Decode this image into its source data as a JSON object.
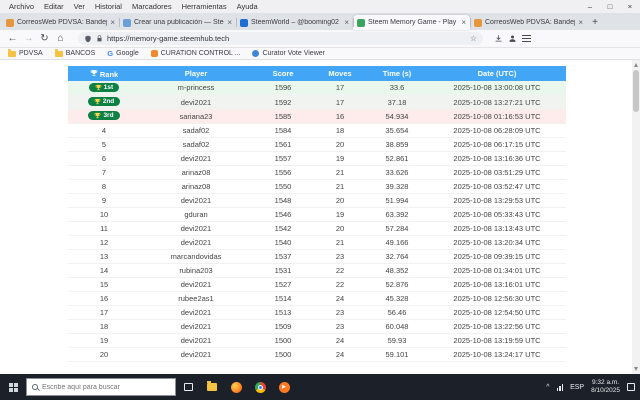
{
  "window_controls": [
    {
      "name": "minimize",
      "glyph": "–"
    },
    {
      "name": "maximize",
      "glyph": "□"
    },
    {
      "name": "close",
      "glyph": "×"
    }
  ],
  "menu_bar": {
    "items": [
      "Archivo",
      "Editar",
      "Ver",
      "Historial",
      "Marcadores",
      "Herramientas",
      "Ayuda"
    ]
  },
  "tab_strip": {
    "tabs": [
      {
        "label": "CorreosWeb PDVSA: Bandeja de",
        "favicon_color": "#e8963d",
        "active": false
      },
      {
        "label": "Crear una publicación — Steen",
        "favicon_color": "#6a9fd8",
        "active": false
      },
      {
        "label": "SteemWorld – @booming02",
        "favicon_color": "#1f6fd0",
        "active": false
      },
      {
        "label": "Steem Memory Game - Play an",
        "favicon_color": "#3aa55f",
        "active": true
      },
      {
        "label": "CorreosWeb PDVSA: Bandeja de",
        "favicon_color": "#e8963d",
        "active": false
      }
    ],
    "new_tab_label": "+"
  },
  "nav_bar": {
    "buttons": [
      {
        "name": "back",
        "glyph": "←",
        "disabled": false
      },
      {
        "name": "forward",
        "glyph": "→",
        "disabled": true
      },
      {
        "name": "reload",
        "glyph": "↻",
        "disabled": false
      },
      {
        "name": "home",
        "glyph": "⌂",
        "disabled": false
      }
    ],
    "url": "https://memory-game.steemhub.tech",
    "bookmark_star": "☆"
  },
  "bookmarks_bar": {
    "items": [
      {
        "label": "PDVSA",
        "icon": "folder"
      },
      {
        "label": "BANCOS",
        "icon": "folder"
      },
      {
        "label": "Google",
        "icon": "google"
      },
      {
        "label": "CURATION CONTROL ...",
        "icon": "orange"
      },
      {
        "label": "Curator Vote Viewer",
        "icon": "globe"
      }
    ]
  },
  "leaderboard": {
    "headers": [
      "Rank",
      "Player",
      "Score",
      "Moves",
      "Time (s)",
      "Date (UTC)"
    ],
    "header_color": "#42a5f5",
    "badge_color": "#0d8043",
    "rows": [
      {
        "rank": "1st",
        "badge": true,
        "highlight": "first",
        "player": "m-princess",
        "score": "1596",
        "moves": "17",
        "time": "33.6",
        "date": "2025-10-08 13:00:08 UTC"
      },
      {
        "rank": "2nd",
        "badge": true,
        "highlight": "second",
        "player": "devi2021",
        "score": "1592",
        "moves": "17",
        "time": "37.18",
        "date": "2025-10-08 13:27:21 UTC"
      },
      {
        "rank": "3rd",
        "badge": true,
        "highlight": "third",
        "player": "sariana23",
        "score": "1585",
        "moves": "16",
        "time": "54.934",
        "date": "2025-10-08 01:16:53 UTC"
      },
      {
        "rank": "4",
        "badge": false,
        "highlight": null,
        "player": "sadaf02",
        "score": "1584",
        "moves": "18",
        "time": "35.654",
        "date": "2025-10-08 06:28:09 UTC"
      },
      {
        "rank": "5",
        "badge": false,
        "highlight": null,
        "player": "sadaf02",
        "score": "1561",
        "moves": "20",
        "time": "38.859",
        "date": "2025-10-08 06:17:15 UTC"
      },
      {
        "rank": "6",
        "badge": false,
        "highlight": null,
        "player": "devi2021",
        "score": "1557",
        "moves": "19",
        "time": "52.861",
        "date": "2025-10-08 13:16:36 UTC"
      },
      {
        "rank": "7",
        "badge": false,
        "highlight": null,
        "player": "arinaz08",
        "score": "1556",
        "moves": "21",
        "time": "33.626",
        "date": "2025-10-08 03:51:29 UTC"
      },
      {
        "rank": "8",
        "badge": false,
        "highlight": null,
        "player": "arinaz08",
        "score": "1550",
        "moves": "21",
        "time": "39.328",
        "date": "2025-10-08 03:52:47 UTC"
      },
      {
        "rank": "9",
        "badge": false,
        "highlight": null,
        "player": "devi2021",
        "score": "1548",
        "moves": "20",
        "time": "51.994",
        "date": "2025-10-08 13:29:53 UTC"
      },
      {
        "rank": "10",
        "badge": false,
        "highlight": null,
        "player": "gduran",
        "score": "1546",
        "moves": "19",
        "time": "63.392",
        "date": "2025-10-08 05:33:43 UTC"
      },
      {
        "rank": "11",
        "badge": false,
        "highlight": null,
        "player": "devi2021",
        "score": "1542",
        "moves": "20",
        "time": "57.284",
        "date": "2025-10-08 13:13:43 UTC"
      },
      {
        "rank": "12",
        "badge": false,
        "highlight": null,
        "player": "devi2021",
        "score": "1540",
        "moves": "21",
        "time": "49.166",
        "date": "2025-10-08 13:20:34 UTC"
      },
      {
        "rank": "13",
        "badge": false,
        "highlight": null,
        "player": "marcandovidas",
        "score": "1537",
        "moves": "23",
        "time": "32.764",
        "date": "2025-10-08 09:39:15 UTC"
      },
      {
        "rank": "14",
        "badge": false,
        "highlight": null,
        "player": "rubina203",
        "score": "1531",
        "moves": "22",
        "time": "48.352",
        "date": "2025-10-08 01:34:01 UTC"
      },
      {
        "rank": "15",
        "badge": false,
        "highlight": null,
        "player": "devi2021",
        "score": "1527",
        "moves": "22",
        "time": "52.876",
        "date": "2025-10-08 13:16:01 UTC"
      },
      {
        "rank": "16",
        "badge": false,
        "highlight": null,
        "player": "rubee2as1",
        "score": "1514",
        "moves": "24",
        "time": "45.328",
        "date": "2025-10-08 12:56:30 UTC"
      },
      {
        "rank": "17",
        "badge": false,
        "highlight": null,
        "player": "devi2021",
        "score": "1513",
        "moves": "23",
        "time": "56.46",
        "date": "2025-10-08 12:54:50 UTC"
      },
      {
        "rank": "18",
        "badge": false,
        "highlight": null,
        "player": "devi2021",
        "score": "1509",
        "moves": "23",
        "time": "60.048",
        "date": "2025-10-08 13:22:56 UTC"
      },
      {
        "rank": "19",
        "badge": false,
        "highlight": null,
        "player": "devi2021",
        "score": "1500",
        "moves": "24",
        "time": "59.93",
        "date": "2025-10-08 13:19:59 UTC"
      },
      {
        "rank": "20",
        "badge": false,
        "highlight": null,
        "player": "devi2021",
        "score": "1500",
        "moves": "24",
        "time": "59.101",
        "date": "2025-10-08 13:24:17 UTC"
      }
    ]
  },
  "taskbar": {
    "search_placeholder": "Escribe aquí para buscar",
    "apps": [
      "task-view",
      "file-explorer",
      "firefox",
      "chrome",
      "media-player"
    ],
    "media_play_glyph": "▶",
    "tray": {
      "chevron": "^",
      "language": "ESP",
      "time": "9:32 a.m.",
      "date": "8/10/2025"
    }
  }
}
